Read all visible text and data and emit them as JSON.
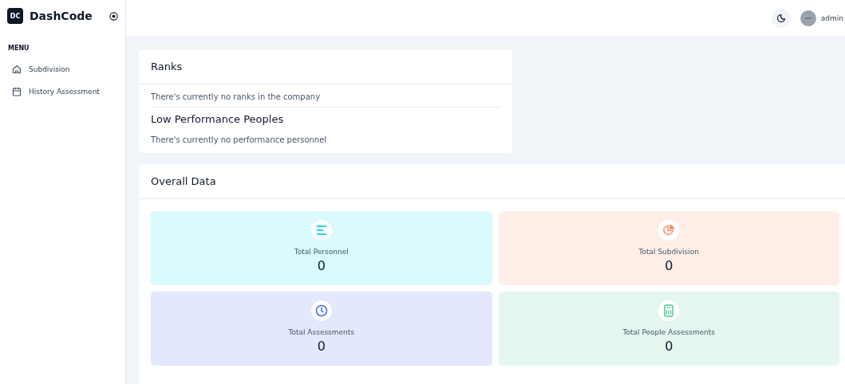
{
  "brand": {
    "logo": "DC",
    "name": "DashCode"
  },
  "sidebar": {
    "heading": "MENU",
    "items": [
      {
        "label": "Subdivision",
        "kind": "home"
      },
      {
        "label": "History Assessment",
        "kind": "calendar"
      }
    ]
  },
  "header": {
    "user": "admin"
  },
  "ranks": {
    "title": "Ranks",
    "message": "There's currently no ranks in the company",
    "low_title": "Low Performance Peoples",
    "low_message": "There's currently no performance personnel"
  },
  "overall": {
    "title": "Overall Data",
    "stats": [
      {
        "label": "Total Personnel",
        "value": "0",
        "kind": "bars",
        "color": "#dafafd"
      },
      {
        "label": "Total Subdivision",
        "value": "0",
        "kind": "pie",
        "color": "#ffeee8"
      },
      {
        "label": "Total Assessments",
        "value": "0",
        "kind": "clock",
        "color": "#e3e8fd"
      },
      {
        "label": "Total People Assessments",
        "value": "0",
        "kind": "calculator",
        "color": "#e5f6ef"
      }
    ]
  }
}
